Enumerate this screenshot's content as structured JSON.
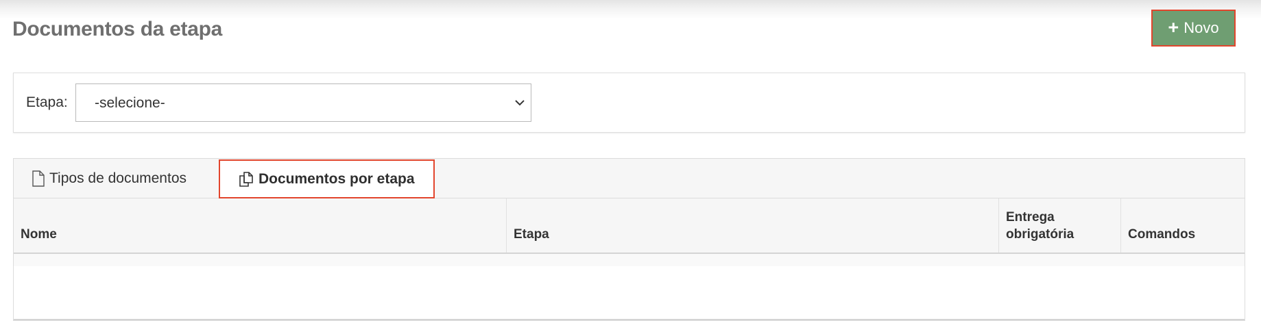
{
  "header": {
    "title": "Documentos da etapa",
    "new_button_label": "Novo",
    "new_button_icon": "plus-icon"
  },
  "filter": {
    "label": "Etapa:",
    "select_value": "-selecione-"
  },
  "tabs": [
    {
      "label": "Tipos de documentos",
      "icon": "document-icon",
      "active": false
    },
    {
      "label": "Documentos por etapa",
      "icon": "documents-copy-icon",
      "active": true
    }
  ],
  "grid": {
    "columns": [
      "Nome",
      "Etapa",
      "Entrega obrigatória",
      "Comandos"
    ],
    "rows": []
  },
  "colors": {
    "primary_button": "#6f9e72",
    "highlight_border": "#e2452c",
    "title_text": "#6f6f6f"
  }
}
